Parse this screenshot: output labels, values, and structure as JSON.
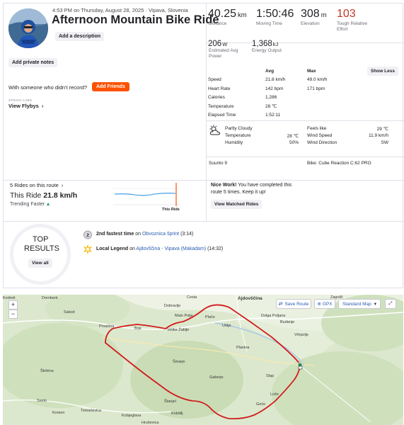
{
  "header": {
    "meta": "4:53 PM on Thursday, August 28, 2025 · Vipava, Slovenia",
    "title": "Afternoon Mountain Bike Ride",
    "add_description": "Add a description",
    "add_private_notes": "Add private notes",
    "with_someone": "With someone who didn't record?",
    "add_friends": "Add Friends",
    "strava_labs": "STRAVA LABS",
    "view_flybys": "View Flybys"
  },
  "primary_stats": [
    {
      "value": "40.25",
      "unit": "km",
      "label": "Distance"
    },
    {
      "value": "1:50:46",
      "unit": "",
      "label": "Moving Time"
    },
    {
      "value": "308",
      "unit": "m",
      "label": "Elevation"
    },
    {
      "value": "103",
      "unit": "",
      "label": "Tough Relative Effort"
    }
  ],
  "secondary_stats": [
    {
      "value": "206",
      "unit": "W",
      "label": "Estimated Avg Power"
    },
    {
      "value": "1,368",
      "unit": "kJ",
      "label": "Energy Output"
    }
  ],
  "detail_table": {
    "col_avg": "Avg",
    "col_max": "Max",
    "show_less": "Show Less",
    "rows": [
      {
        "label": "Speed",
        "avg": "21.8 km/h",
        "max": "49.0 km/h"
      },
      {
        "label": "Heart Rate",
        "avg": "142 bpm",
        "max": "171 bpm"
      },
      {
        "label": "Calories",
        "avg": "1,286",
        "max": ""
      },
      {
        "label": "Temperature",
        "avg": "28 ℃",
        "max": ""
      },
      {
        "label": "Elapsed Time",
        "avg": "1:52:11",
        "max": ""
      }
    ]
  },
  "weather": {
    "icon": "partly-cloudy-icon",
    "condition": "Partly Cloudy",
    "temperature_label": "Temperature",
    "temperature": "28 ℃",
    "humidity_label": "Humidity",
    "humidity": "50%",
    "feels_like_label": "Feels like",
    "feels_like": "29 ℃",
    "wind_speed_label": "Wind Speed",
    "wind_speed": "11.9 km/h",
    "wind_direction_label": "Wind Direction",
    "wind_direction": "SW"
  },
  "device": "Suunto 9",
  "bike": "Bike: Cube Reaction C:62 PRO",
  "route": {
    "rides_on_route": "5 Rides on this route",
    "this_ride_prefix": "This Ride",
    "this_ride_speed": "21.8 km/h",
    "trending": "Trending Faster",
    "chart_marker_label": "This Ride",
    "nice_work_bold": "Nice Work!",
    "nice_work_text": " You have completed this route 5 times. Keep it up!",
    "view_matched": "View Matched Rides"
  },
  "top_results": {
    "title_line1": "TOP",
    "title_line2": "RESULTS",
    "view_all": "View all",
    "items": [
      {
        "bold": "2nd fastest time",
        "mid": " on ",
        "link": "Obvoznica šprint",
        "tail": " (3:14)"
      },
      {
        "bold": "Local Legend",
        "mid": " on ",
        "link": "Ajdovščina - Vipava (Makadam)",
        "tail": " (14:32)"
      }
    ]
  },
  "map": {
    "save_route": "Save Route",
    "gpx": "GPX",
    "map_style": "Standard Map",
    "zoom_in": "+",
    "zoom_out": "−",
    "places": [
      "Ajdovščina",
      "Dornberk",
      "Sakod",
      "Prvačina",
      "Dobravlje",
      "Cesta",
      "Malo Polje",
      "Plače",
      "Brje",
      "Velike Žablje",
      "Uštje",
      "Dolga Poljana",
      "Budanje",
      "Zagolič",
      "Vrhpolje",
      "Planina",
      "Šmarje",
      "Gaberje",
      "Slap",
      "Lože",
      "Goče",
      "Štanjel",
      "Kobdilj",
      "Kobjeglava",
      "Tomačevica",
      "Komen",
      "Škrbina",
      "Sveto",
      "Hruševica",
      "Kodreti"
    ]
  }
}
